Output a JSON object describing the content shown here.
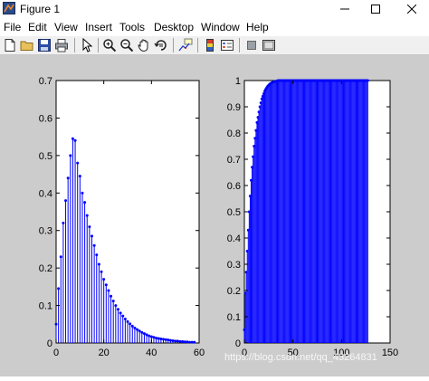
{
  "window": {
    "title": "Figure 1"
  },
  "menu": [
    "File",
    "Edit",
    "View",
    "Insert",
    "Tools",
    "Desktop",
    "Window",
    "Help"
  ],
  "toolbar": {
    "icons": [
      "new-figure-icon",
      "open-file-icon",
      "save-icon",
      "print-icon",
      "edit-plot-arrow-icon",
      "zoom-in-icon",
      "zoom-out-icon",
      "pan-hand-icon",
      "rotate-3d-icon",
      "data-cursor-icon",
      "colorbar-icon",
      "legend-icon",
      "hide-plot-tools-icon",
      "show-plot-tools-icon"
    ]
  },
  "watermark": "https://blog.csdn.net/qq_43264831",
  "colors": {
    "stem": "#0000ff",
    "figure_bg": "#cccccc",
    "axes_bg": "#ffffff"
  },
  "chart_data": [
    {
      "type": "stem",
      "xlim": [
        0,
        60
      ],
      "ylim": [
        0,
        0.7
      ],
      "xticks": [
        "0",
        "20",
        "40",
        "60"
      ],
      "yticks": [
        "0",
        "0.1",
        "0.2",
        "0.3",
        "0.4",
        "0.5",
        "0.6",
        "0.7"
      ],
      "x": [
        0,
        1,
        2,
        3,
        4,
        5,
        6,
        7,
        8,
        9,
        10,
        11,
        12,
        13,
        14,
        15,
        16,
        17,
        18,
        19,
        20,
        21,
        22,
        23,
        24,
        25,
        26,
        27,
        28,
        29,
        30,
        31,
        32,
        33,
        34,
        35,
        36,
        37,
        38,
        39,
        40,
        41,
        42,
        43,
        44,
        45,
        46,
        47,
        48,
        49,
        50,
        51,
        52,
        53,
        54,
        55,
        56,
        57,
        58
      ],
      "y": [
        0.05,
        0.145,
        0.23,
        0.32,
        0.38,
        0.44,
        0.5,
        0.545,
        0.54,
        0.48,
        0.445,
        0.4,
        0.375,
        0.34,
        0.31,
        0.285,
        0.26,
        0.235,
        0.21,
        0.19,
        0.17,
        0.155,
        0.14,
        0.125,
        0.112,
        0.1,
        0.09,
        0.08,
        0.072,
        0.064,
        0.057,
        0.051,
        0.045,
        0.04,
        0.036,
        0.032,
        0.028,
        0.025,
        0.022,
        0.019,
        0.017,
        0.015,
        0.013,
        0.012,
        0.011,
        0.01,
        0.009,
        0.008,
        0.007,
        0.006,
        0.005,
        0.005,
        0.004,
        0.004,
        0.003,
        0.003,
        0.002,
        0.002,
        0.002
      ]
    },
    {
      "type": "stem",
      "xlim": [
        0,
        150
      ],
      "ylim": [
        0,
        1
      ],
      "xticks": [
        "0",
        "50",
        "100",
        "150"
      ],
      "yticks": [
        "0",
        "0.1",
        "0.2",
        "0.3",
        "0.4",
        "0.5",
        "0.6",
        "0.7",
        "0.8",
        "0.9",
        "1"
      ],
      "n_points": 128,
      "y_first": [
        0.05,
        0.19,
        0.27,
        0.35,
        0.43,
        0.5,
        0.56,
        0.62,
        0.67,
        0.71,
        0.75,
        0.78,
        0.81,
        0.84,
        0.86,
        0.88,
        0.9,
        0.915,
        0.93,
        0.94,
        0.95,
        0.96,
        0.967,
        0.973,
        0.978,
        0.982,
        0.986,
        0.989,
        0.991,
        0.993,
        0.995,
        0.996,
        0.997,
        0.998,
        0.999
      ],
      "y_rest": 1
    }
  ]
}
